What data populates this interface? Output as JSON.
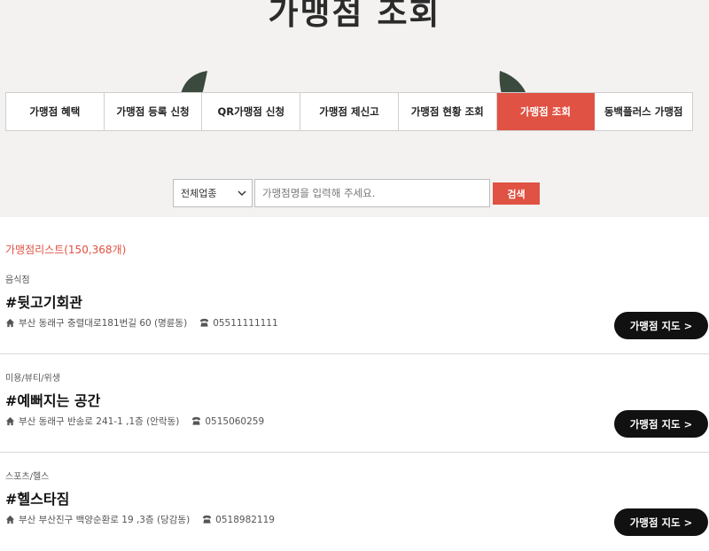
{
  "page": {
    "title": "가맹점 조회"
  },
  "tabs": [
    {
      "label": "가맹점 혜택"
    },
    {
      "label": "가맹점 등록 신청"
    },
    {
      "label": "QR가맹점 신청"
    },
    {
      "label": "가맹점 제신고"
    },
    {
      "label": "가맹점 현황 조회"
    },
    {
      "label": "가맹점 조회",
      "active": true
    },
    {
      "label": "동백플러스 가맹점"
    }
  ],
  "search": {
    "category_selected": "전체업종",
    "placeholder": "가맹점명을 입력해 주세요.",
    "button_label": "검색"
  },
  "list": {
    "header": "가맹점리스트(150,368개)",
    "items": [
      {
        "category": "음식점",
        "name": "#뒷고기회관",
        "address": "부산 동래구 충렬대로181번길 60 (명륜동)",
        "phone": "05511111111",
        "map_label": "가맹점 지도 >"
      },
      {
        "category": "미용/뷰티/위생",
        "name": "#예뻐지는 공간",
        "address": "부산 동래구 반송로 241-1 ,1층 (안락동)",
        "phone": "0515060259",
        "map_label": "가맹점 지도 >"
      },
      {
        "category": "스포츠/헬스",
        "name": "#헬스타짐",
        "address": "부산 부산진구 백양순환로 19 ,3층 (당감동)",
        "phone": "0518982119",
        "map_label": "가맹점 지도 >"
      }
    ]
  },
  "colors": {
    "accent": "#e05243",
    "dark": "#111111",
    "leaf": "#3a4a3d"
  },
  "icons": {
    "address": "home-icon",
    "phone": "phone-icon",
    "select": "chevron-down-icon"
  }
}
